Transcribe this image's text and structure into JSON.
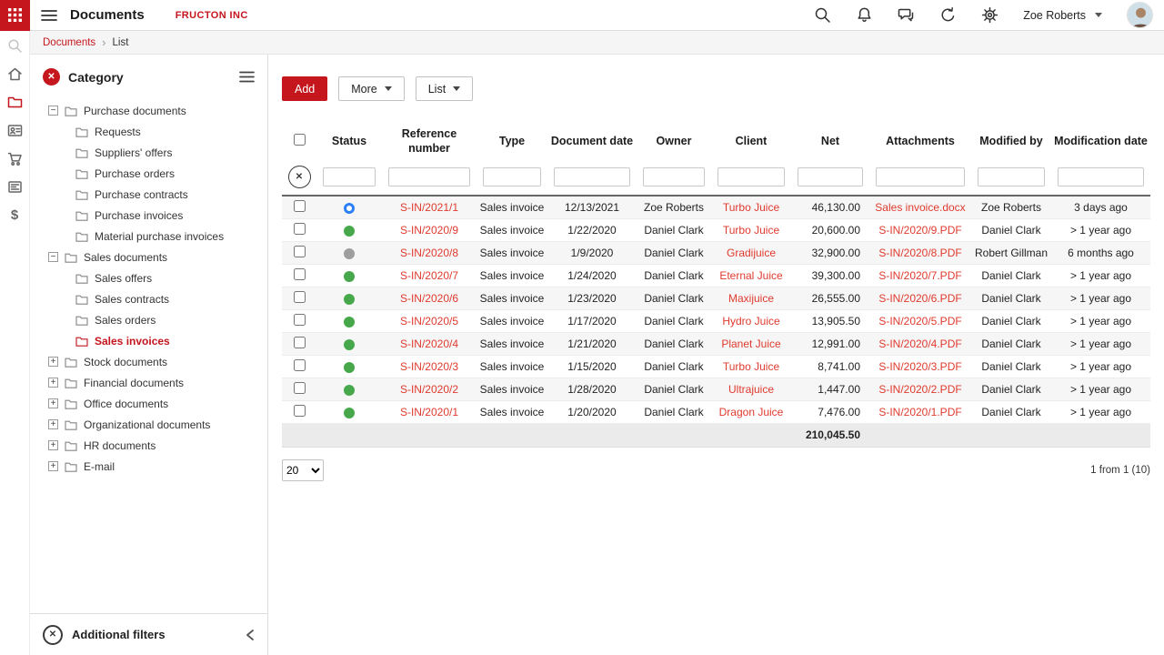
{
  "colors": {
    "brand_red": "#c4161c",
    "link_red": "#e03a2e",
    "status_green": "#46a84b",
    "status_gray": "#9e9e9e",
    "status_blue": "#2d7ff9"
  },
  "topbar": {
    "title": "Documents",
    "company": "FRUCTON INC",
    "user_name": "Zoe Roberts"
  },
  "breadcrumb": {
    "section": "Documents",
    "page": "List"
  },
  "category_panel": {
    "title": "Category",
    "additional_filters_label": "Additional filters",
    "selected_item": "Sales invoices",
    "tree": [
      {
        "label": "Purchase documents",
        "state": "expanded",
        "children": [
          "Requests",
          "Suppliers' offers",
          "Purchase orders",
          "Purchase contracts",
          "Purchase invoices",
          "Material purchase invoices"
        ]
      },
      {
        "label": "Sales documents",
        "state": "expanded",
        "children": [
          "Sales offers",
          "Sales contracts",
          "Sales orders",
          "Sales invoices"
        ]
      },
      {
        "label": "Stock documents",
        "state": "collapsed"
      },
      {
        "label": "Financial documents",
        "state": "collapsed"
      },
      {
        "label": "Office documents",
        "state": "collapsed"
      },
      {
        "label": "Organizational documents",
        "state": "collapsed"
      },
      {
        "label": "HR documents",
        "state": "collapsed"
      },
      {
        "label": "E-mail",
        "state": "collapsed"
      }
    ]
  },
  "toolbar": {
    "add_label": "Add",
    "more_label": "More",
    "list_label": "List"
  },
  "table": {
    "columns": [
      "Status",
      "Reference number",
      "Type",
      "Document date",
      "Owner",
      "Client",
      "Net",
      "Attachments",
      "Modified by",
      "Modification date"
    ],
    "rows": [
      {
        "status": "blue",
        "ref": "S-IN/2021/1",
        "type": "Sales invoice",
        "date": "12/13/2021",
        "owner": "Zoe Roberts",
        "client": "Turbo Juice",
        "net": "46,130.00",
        "attachment": "Sales invoice.docx",
        "modified_by": "Zoe Roberts",
        "modified": "3 days ago"
      },
      {
        "status": "green",
        "ref": "S-IN/2020/9",
        "type": "Sales invoice",
        "date": "1/22/2020",
        "owner": "Daniel Clark",
        "client": "Turbo Juice",
        "net": "20,600.00",
        "attachment": "S-IN/2020/9.PDF",
        "modified_by": "Daniel Clark",
        "modified": "> 1 year ago"
      },
      {
        "status": "gray",
        "ref": "S-IN/2020/8",
        "type": "Sales invoice",
        "date": "1/9/2020",
        "owner": "Daniel Clark",
        "client": "Gradijuice",
        "net": "32,900.00",
        "attachment": "S-IN/2020/8.PDF",
        "modified_by": "Robert Gillman",
        "modified": "6 months ago"
      },
      {
        "status": "green",
        "ref": "S-IN/2020/7",
        "type": "Sales invoice",
        "date": "1/24/2020",
        "owner": "Daniel Clark",
        "client": "Eternal Juice",
        "net": "39,300.00",
        "attachment": "S-IN/2020/7.PDF",
        "modified_by": "Daniel Clark",
        "modified": "> 1 year ago"
      },
      {
        "status": "green",
        "ref": "S-IN/2020/6",
        "type": "Sales invoice",
        "date": "1/23/2020",
        "owner": "Daniel Clark",
        "client": "Maxijuice",
        "net": "26,555.00",
        "attachment": "S-IN/2020/6.PDF",
        "modified_by": "Daniel Clark",
        "modified": "> 1 year ago"
      },
      {
        "status": "green",
        "ref": "S-IN/2020/5",
        "type": "Sales invoice",
        "date": "1/17/2020",
        "owner": "Daniel Clark",
        "client": "Hydro Juice",
        "net": "13,905.50",
        "attachment": "S-IN/2020/5.PDF",
        "modified_by": "Daniel Clark",
        "modified": "> 1 year ago"
      },
      {
        "status": "green",
        "ref": "S-IN/2020/4",
        "type": "Sales invoice",
        "date": "1/21/2020",
        "owner": "Daniel Clark",
        "client": "Planet Juice",
        "net": "12,991.00",
        "attachment": "S-IN/2020/4.PDF",
        "modified_by": "Daniel Clark",
        "modified": "> 1 year ago"
      },
      {
        "status": "green",
        "ref": "S-IN/2020/3",
        "type": "Sales invoice",
        "date": "1/15/2020",
        "owner": "Daniel Clark",
        "client": "Turbo Juice",
        "net": "8,741.00",
        "attachment": "S-IN/2020/3.PDF",
        "modified_by": "Daniel Clark",
        "modified": "> 1 year ago"
      },
      {
        "status": "green",
        "ref": "S-IN/2020/2",
        "type": "Sales invoice",
        "date": "1/28/2020",
        "owner": "Daniel Clark",
        "client": "Ultrajuice",
        "net": "1,447.00",
        "attachment": "S-IN/2020/2.PDF",
        "modified_by": "Daniel Clark",
        "modified": "> 1 year ago"
      },
      {
        "status": "green",
        "ref": "S-IN/2020/1",
        "type": "Sales invoice",
        "date": "1/20/2020",
        "owner": "Daniel Clark",
        "client": "Dragon Juice",
        "net": "7,476.00",
        "attachment": "S-IN/2020/1.PDF",
        "modified_by": "Daniel Clark",
        "modified": "> 1 year ago"
      }
    ],
    "total_net": "210,045.50"
  },
  "pagination": {
    "page_size": "20",
    "summary": "1 from 1 (10)"
  }
}
